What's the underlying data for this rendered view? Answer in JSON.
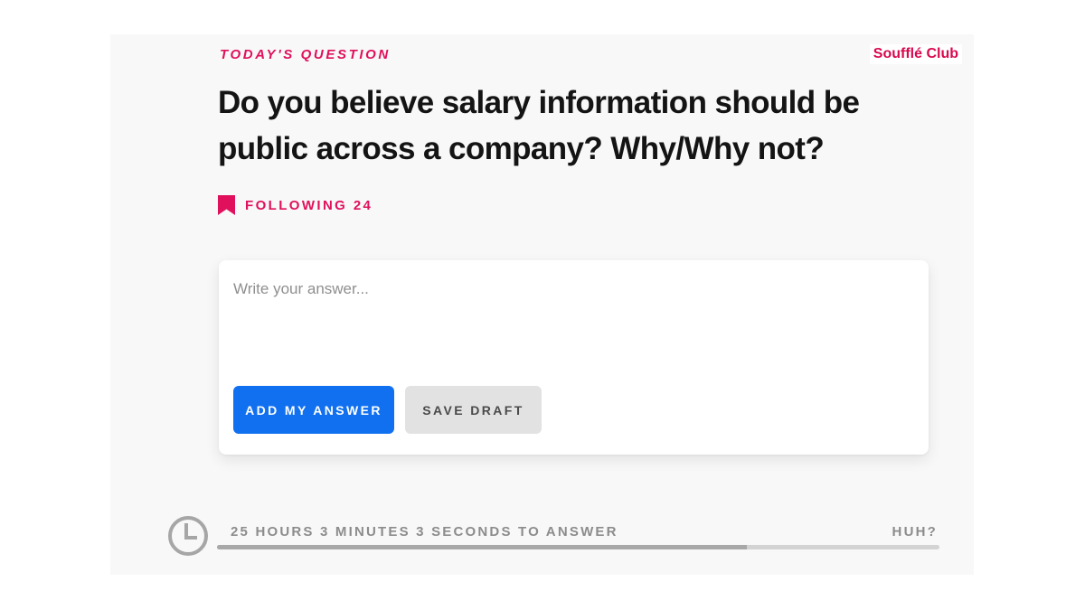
{
  "kicker": "TODAY'S QUESTION",
  "brand": "Soufflé Club",
  "question": "Do you believe salary information should be public across a company? Why/Why not?",
  "following": {
    "label": "FOLLOWING 24",
    "icon": "bookmark-icon"
  },
  "answer_box": {
    "placeholder": "Write your answer...",
    "value": ""
  },
  "buttons": {
    "add": "ADD MY ANSWER",
    "save": "SAVE DRAFT"
  },
  "timer": {
    "text": "25 HOURS 3 MINUTES 3 SECONDS TO ANSWER",
    "help": "HUH?",
    "progress_fraction": 0.733,
    "icon": "clock-icon"
  },
  "colors": {
    "accent": "#e0105c",
    "primary_button": "#1170f0",
    "secondary_button": "#e2e2e2",
    "progress_fill": "#a8a8a8",
    "progress_track": "#d3d3d3"
  }
}
